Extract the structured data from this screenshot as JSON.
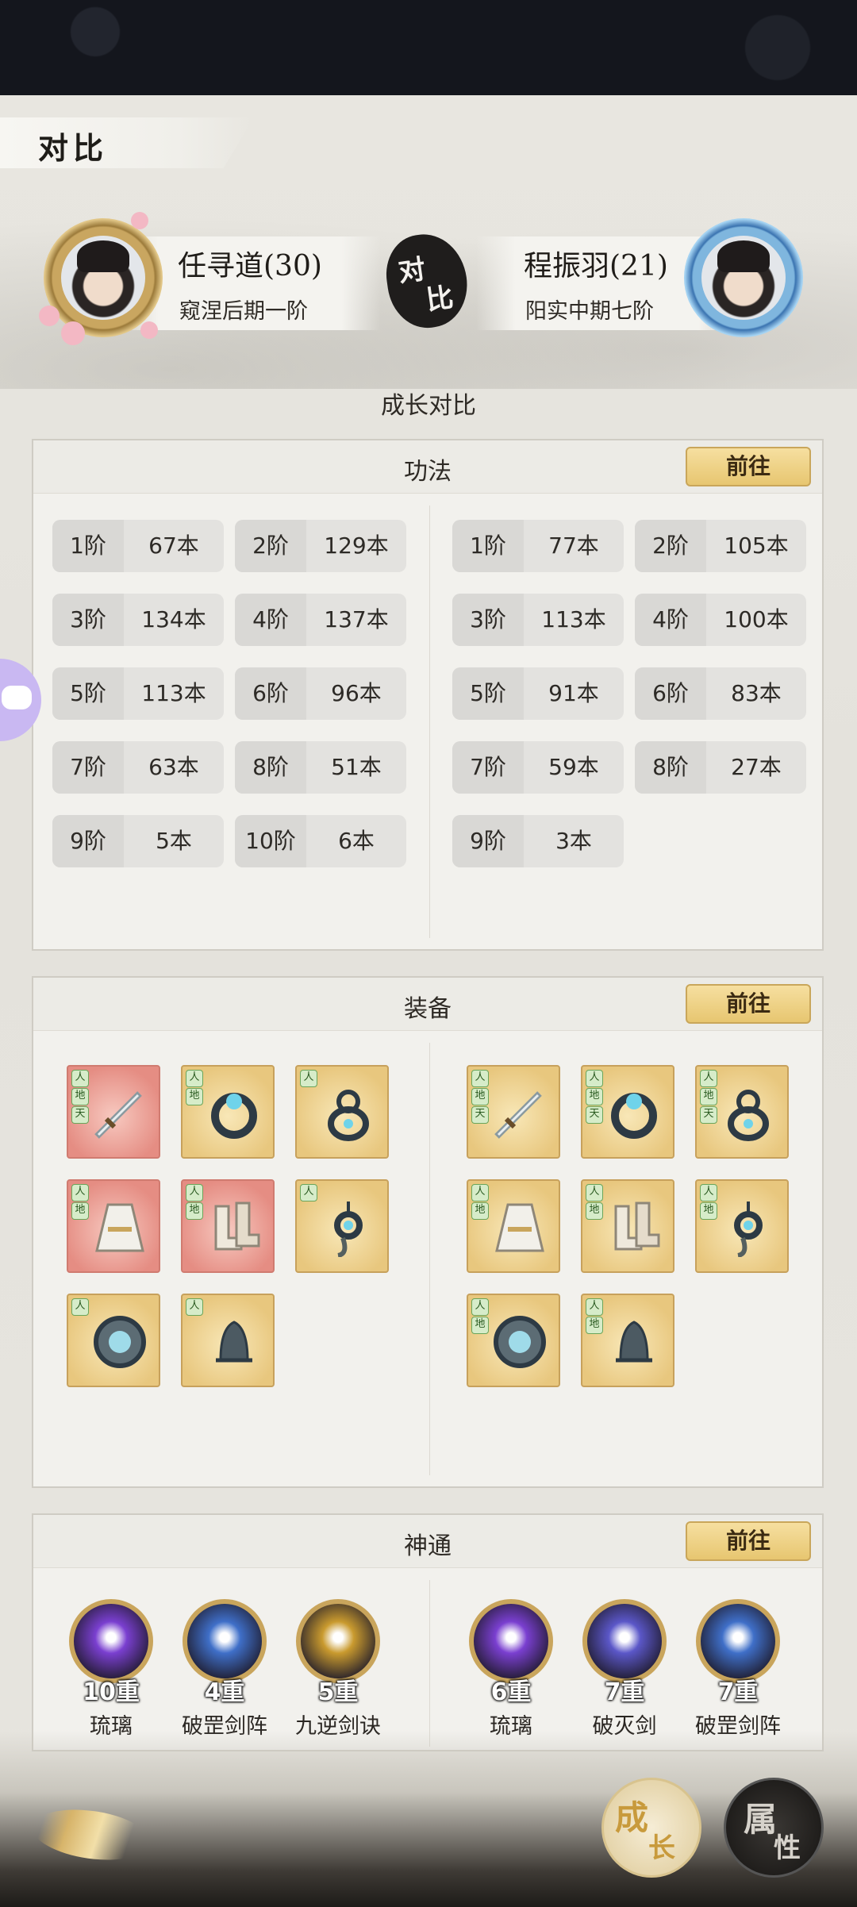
{
  "header": {
    "title": "对比"
  },
  "players": {
    "left": {
      "name": "任寻道(30)",
      "realm": "窥涅后期一阶"
    },
    "right": {
      "name": "程振羽(21)",
      "realm": "阳实中期七阶"
    },
    "vs": [
      "对",
      "比"
    ]
  },
  "section_title": "成长对比",
  "goto_label": "前往",
  "gongfa": {
    "title": "功法",
    "left": [
      {
        "tier": "1阶",
        "count": "67本"
      },
      {
        "tier": "2阶",
        "count": "129本"
      },
      {
        "tier": "3阶",
        "count": "134本"
      },
      {
        "tier": "4阶",
        "count": "137本"
      },
      {
        "tier": "5阶",
        "count": "113本"
      },
      {
        "tier": "6阶",
        "count": "96本"
      },
      {
        "tier": "7阶",
        "count": "63本"
      },
      {
        "tier": "8阶",
        "count": "51本"
      },
      {
        "tier": "9阶",
        "count": "5本"
      },
      {
        "tier": "10阶",
        "count": "6本"
      }
    ],
    "right": [
      {
        "tier": "1阶",
        "count": "77本"
      },
      {
        "tier": "2阶",
        "count": "105本"
      },
      {
        "tier": "3阶",
        "count": "113本"
      },
      {
        "tier": "4阶",
        "count": "100本"
      },
      {
        "tier": "5阶",
        "count": "91本"
      },
      {
        "tier": "6阶",
        "count": "83本"
      },
      {
        "tier": "7阶",
        "count": "59本"
      },
      {
        "tier": "8阶",
        "count": "27本"
      },
      {
        "tier": "9阶",
        "count": "3本"
      }
    ]
  },
  "equipment": {
    "title": "装备",
    "left": [
      {
        "icon": "sword-icon",
        "rarity": "red",
        "tags": [
          "人",
          "地",
          "天"
        ]
      },
      {
        "icon": "bracelet-icon",
        "rarity": "gold",
        "tags": [
          "人",
          "地"
        ]
      },
      {
        "icon": "gourd-icon",
        "rarity": "gold",
        "tags": [
          "人"
        ]
      },
      {
        "icon": "robe-icon",
        "rarity": "red",
        "tags": [
          "人",
          "地"
        ]
      },
      {
        "icon": "boots-icon",
        "rarity": "red",
        "tags": [
          "人",
          "地"
        ]
      },
      {
        "icon": "pendant-icon",
        "rarity": "gold",
        "tags": [
          "人"
        ]
      },
      {
        "icon": "mirror-icon",
        "rarity": "gold",
        "tags": [
          "人"
        ]
      },
      {
        "icon": "bell-icon",
        "rarity": "gold",
        "tags": [
          "人"
        ]
      }
    ],
    "right": [
      {
        "icon": "sword-icon",
        "rarity": "gold",
        "tags": [
          "人",
          "地",
          "天"
        ]
      },
      {
        "icon": "bracelet-icon",
        "rarity": "gold",
        "tags": [
          "人",
          "地",
          "天"
        ]
      },
      {
        "icon": "gourd-icon",
        "rarity": "gold",
        "tags": [
          "人",
          "地",
          "天"
        ]
      },
      {
        "icon": "robe-icon",
        "rarity": "gold",
        "tags": [
          "人",
          "地"
        ]
      },
      {
        "icon": "boots-icon",
        "rarity": "gold",
        "tags": [
          "人",
          "地"
        ]
      },
      {
        "icon": "pendant-icon",
        "rarity": "gold",
        "tags": [
          "人",
          "地"
        ]
      },
      {
        "icon": "mirror-icon",
        "rarity": "gold",
        "tags": [
          "人",
          "地"
        ]
      },
      {
        "icon": "bell-icon",
        "rarity": "gold",
        "tags": [
          "人",
          "地"
        ]
      }
    ]
  },
  "shentong": {
    "title": "神通",
    "left": [
      {
        "level": "10重",
        "name": "琉璃",
        "color": "#7a3fd0"
      },
      {
        "level": "4重",
        "name": "破罡剑阵",
        "color": "#3f6fc8"
      },
      {
        "level": "5重",
        "name": "九逆剑诀",
        "color": "#c99a2e"
      }
    ],
    "right": [
      {
        "level": "6重",
        "name": "琉璃",
        "color": "#7a3fd0"
      },
      {
        "level": "7重",
        "name": "破灭剑",
        "color": "#5b57c8"
      },
      {
        "level": "7重",
        "name": "破罡剑阵",
        "color": "#3f6fc8"
      }
    ]
  },
  "bottom_nav": {
    "growth": [
      "成",
      "长"
    ],
    "attributes": [
      "属",
      "性"
    ]
  }
}
